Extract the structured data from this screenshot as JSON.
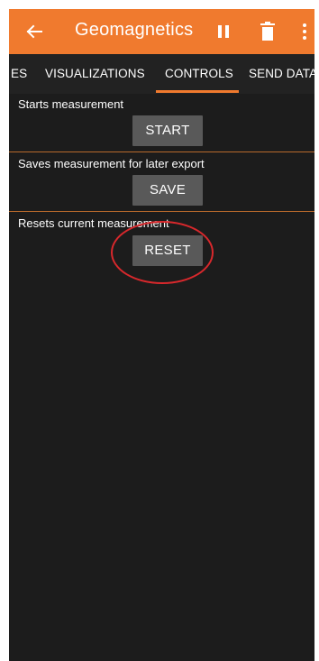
{
  "appbar": {
    "title": "Geomagnetics",
    "back_icon": "arrow-left-icon",
    "pause_icon": "pause-icon",
    "delete_icon": "trash-icon",
    "more_icon": "more-vertical-icon",
    "color": "#f07a2e"
  },
  "tabs": {
    "items": [
      {
        "label": "ES"
      },
      {
        "label": "VISUALIZATIONS"
      },
      {
        "label": "CONTROLS"
      },
      {
        "label": "SEND DATA"
      }
    ],
    "selected": "CONTROLS"
  },
  "controls": {
    "start": {
      "description": "Starts measurement",
      "button_label": "START"
    },
    "save": {
      "description": "Saves measurement for later export",
      "button_label": "SAVE"
    },
    "reset": {
      "description": "Resets current measurement",
      "button_label": "RESET"
    }
  },
  "annotation": {
    "color": "#d8282c"
  }
}
